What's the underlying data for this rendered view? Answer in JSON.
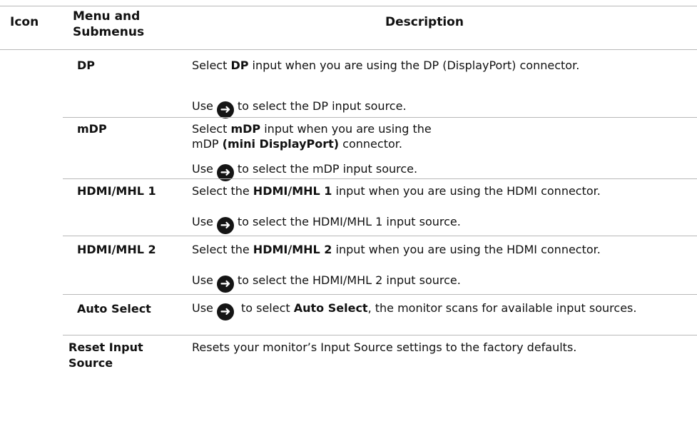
{
  "header": {
    "icon": "Icon",
    "menu_line1": "Menu and",
    "menu_line2": "Submenus",
    "description": "Description"
  },
  "arrow_icon": "arrow-right-circle-icon",
  "rows": [
    {
      "menu": "DP",
      "desc_a": "Select ",
      "desc_b": "DP",
      "desc_c": " input when you are using the DP (DisplayPort) connector.",
      "use_a": "Use",
      "use_b": "to select the DP input source."
    },
    {
      "menu": "mDP",
      "desc_a": "Select ",
      "desc_b": "mDP",
      "desc_c": " input when you are using the",
      "desc_d": "mDP ",
      "desc_e": "(mini DisplayPort)",
      "desc_f": " connector.",
      "use_a": "Use",
      "use_b": "to select the mDP input source."
    },
    {
      "menu": "HDMI/MHL 1",
      "desc_a": "Select the ",
      "desc_b": "HDMI/MHL 1",
      "desc_c": " input when you are using the HDMI connector.",
      "use_a": "Use",
      "use_b": "to select the HDMI/MHL 1 input source."
    },
    {
      "menu": "HDMI/MHL 2",
      "desc_a": "Select the ",
      "desc_b": "HDMI/MHL 2",
      "desc_c": " input when you are using the HDMI connector.",
      "use_a": "Use",
      "use_b": "to select the HDMI/MHL 2 input source."
    },
    {
      "menu": "Auto Select",
      "desc_a": "Use",
      "desc_b": " to select ",
      "desc_c": "Auto Select",
      "desc_d": ", the monitor scans for available input sources."
    },
    {
      "menu_line1": "Reset Input",
      "menu_line2": "Source",
      "desc": "Resets your monitor’s Input Source settings to the factory defaults."
    }
  ]
}
